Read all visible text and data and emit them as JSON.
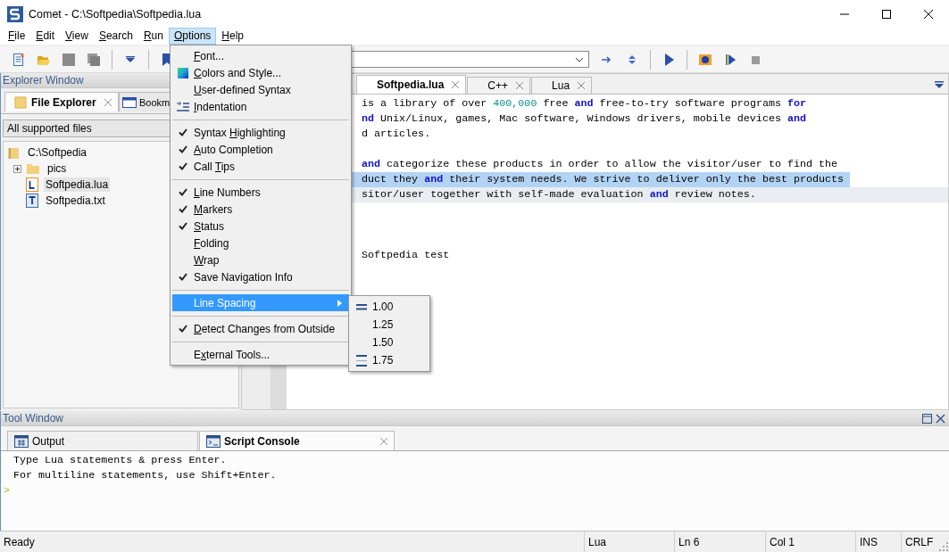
{
  "window": {
    "title": "Comet - C:\\Softpedia\\Softpedia.lua"
  },
  "menu_bar": [
    {
      "label": {
        "key": "F",
        "post": "ile"
      },
      "selected": false
    },
    {
      "label": {
        "key": "E",
        "post": "dit"
      },
      "selected": false
    },
    {
      "label": {
        "key": "V",
        "post": "iew"
      },
      "selected": false
    },
    {
      "label": {
        "key": "S",
        "post": "earch"
      },
      "selected": false
    },
    {
      "label": {
        "key": "R",
        "post": "un"
      },
      "selected": false
    },
    {
      "label": {
        "key": "O",
        "post": "ptions"
      },
      "selected": true
    },
    {
      "label": {
        "key": "H",
        "post": "elp"
      },
      "selected": false
    }
  ],
  "explorer": {
    "title": "Explorer Window",
    "tabs": [
      {
        "label": "File Explorer",
        "selected": true,
        "closable": true
      },
      {
        "label": "Bookm",
        "selected": false,
        "closable": false
      }
    ],
    "filter": {
      "value": "All supported files"
    },
    "tree": [
      {
        "label": "C:\\Softpedia",
        "kind": "folder-root",
        "selected": false,
        "children": [
          {
            "label": "pics",
            "kind": "folder",
            "selected": false,
            "expanded": false
          },
          {
            "label": "Softpedia.lua",
            "kind": "lua",
            "selected": true
          },
          {
            "label": "Softpedia.txt",
            "kind": "text",
            "selected": false
          }
        ]
      }
    ]
  },
  "editor": {
    "tabs": [
      {
        "label": "Softpedia.lua",
        "selected": true
      },
      {
        "label": "C++",
        "selected": false
      },
      {
        "label": "Lua",
        "selected": false
      }
    ],
    "lines": [
      {
        "kind": "text",
        "selected": false,
        "current": false,
        "segments": [
          {
            "text": "is a library of over ",
            "kind": "plain"
          },
          {
            "text": "400,000",
            "kind": "number"
          },
          {
            "text": " free ",
            "kind": "plain"
          },
          {
            "text": "and",
            "kind": "keyword"
          },
          {
            "text": " free-to-try software programs ",
            "kind": "plain"
          },
          {
            "text": "for",
            "kind": "keyword"
          }
        ]
      },
      {
        "kind": "text",
        "selected": false,
        "current": false,
        "segments": [
          {
            "text": "nd",
            "kind": "keyword"
          },
          {
            "text": " Unix/Linux, games, Mac software, Windows drivers, mobile devices ",
            "kind": "plain"
          },
          {
            "text": "and",
            "kind": "keyword"
          }
        ]
      },
      {
        "kind": "text",
        "selected": false,
        "current": false,
        "segments": [
          {
            "text": "d articles.",
            "kind": "plain"
          }
        ]
      },
      {
        "kind": "blank",
        "selected": false,
        "current": false
      },
      {
        "kind": "text",
        "selected": false,
        "current": false,
        "segments": [
          {
            "text": "and",
            "kind": "keyword"
          },
          {
            "text": " categorize these products in order to allow the visitor/user to find the",
            "kind": "plain"
          }
        ]
      },
      {
        "kind": "text",
        "selected": true,
        "current": false,
        "segments": [
          {
            "text": "duct they ",
            "kind": "plain"
          },
          {
            "text": "and",
            "kind": "keyword"
          },
          {
            "text": " their system needs. We strive to deliver only the best products",
            "kind": "plain"
          }
        ]
      },
      {
        "kind": "text",
        "selected": false,
        "current": true,
        "segments": [
          {
            "text": "sitor/user together with self-made evaluation ",
            "kind": "plain"
          },
          {
            "text": "and",
            "kind": "keyword"
          },
          {
            "text": " review notes.",
            "kind": "plain"
          }
        ]
      },
      {
        "kind": "blank",
        "selected": false,
        "current": false
      },
      {
        "kind": "blank",
        "selected": false,
        "current": false
      },
      {
        "kind": "blank",
        "selected": false,
        "current": false
      },
      {
        "kind": "text",
        "selected": false,
        "current": false,
        "segments": [
          {
            "text": "Softpedia test",
            "kind": "plain"
          }
        ]
      }
    ]
  },
  "options_menu": {
    "items": [
      {
        "kind": "item",
        "label": {
          "key": "F",
          "post": "ont..."
        },
        "checked": false,
        "selected": false
      },
      {
        "kind": "color-item",
        "label": {
          "key": "C",
          "post": "olors and Style..."
        },
        "checked": false,
        "selected": false
      },
      {
        "kind": "item",
        "label": {
          "key": "U",
          "post": "ser-defined Syntax"
        },
        "checked": false,
        "selected": false
      },
      {
        "kind": "indent-item",
        "label": {
          "key": "I",
          "post": "ndentation"
        },
        "checked": false,
        "selected": false
      },
      {
        "kind": "separator"
      },
      {
        "kind": "item",
        "label": {
          "pre": "Syntax ",
          "key": "H",
          "post": "ighlighting"
        },
        "checked": true,
        "selected": false
      },
      {
        "kind": "item",
        "label": {
          "key": "A",
          "post": "uto Completion"
        },
        "checked": true,
        "selected": false
      },
      {
        "kind": "item",
        "label": {
          "pre": "Call ",
          "key": "T",
          "post": "ips"
        },
        "checked": true,
        "selected": false
      },
      {
        "kind": "separator"
      },
      {
        "kind": "item",
        "label": {
          "key": "L",
          "post": "ine Numbers"
        },
        "checked": true,
        "selected": false
      },
      {
        "kind": "item",
        "label": {
          "key": "M",
          "post": "arkers"
        },
        "checked": true,
        "selected": false
      },
      {
        "kind": "item",
        "label": {
          "key": "S",
          "post": "tatus"
        },
        "checked": true,
        "selected": false
      },
      {
        "kind": "item",
        "label": {
          "key": "F",
          "post": "olding"
        },
        "checked": false,
        "selected": false
      },
      {
        "kind": "item",
        "label": {
          "key": "W",
          "post": "rap"
        },
        "checked": false,
        "selected": false
      },
      {
        "kind": "item",
        "label": {
          "pre": "Save Navigation Info"
        },
        "checked": true,
        "selected": false
      },
      {
        "kind": "separator"
      },
      {
        "kind": "submenu",
        "label": {
          "pre": "Line Spacing"
        },
        "checked": false,
        "selected": true
      },
      {
        "kind": "separator"
      },
      {
        "kind": "item",
        "label": {
          "key": "D",
          "post": "etect Changes from Outside"
        },
        "checked": true,
        "selected": false
      },
      {
        "kind": "separator"
      },
      {
        "kind": "item",
        "label": {
          "pre": "E",
          "key": "x",
          "post": "ternal Tools..."
        },
        "checked": false,
        "selected": false
      }
    ]
  },
  "line_spacing_submenu": {
    "items": [
      {
        "label": "1.00",
        "kind": "min"
      },
      {
        "label": "1.25",
        "kind": "plain"
      },
      {
        "label": "1.50",
        "kind": "plain"
      },
      {
        "label": "1.75",
        "kind": "max"
      }
    ]
  },
  "tool_window": {
    "title": "Tool Window",
    "tabs": [
      {
        "label": "Output",
        "kind": "output",
        "selected": false
      },
      {
        "label": "Script Console",
        "kind": "console",
        "selected": true
      }
    ],
    "console_lines": [
      "Type Lua statements & press Enter.",
      "For multiline statements, use Shift+Enter."
    ],
    "prompt": ">"
  },
  "status_bar": [
    "Ready",
    "Lua",
    "Ln 6",
    "Col 1",
    "INS",
    "CRLF"
  ]
}
